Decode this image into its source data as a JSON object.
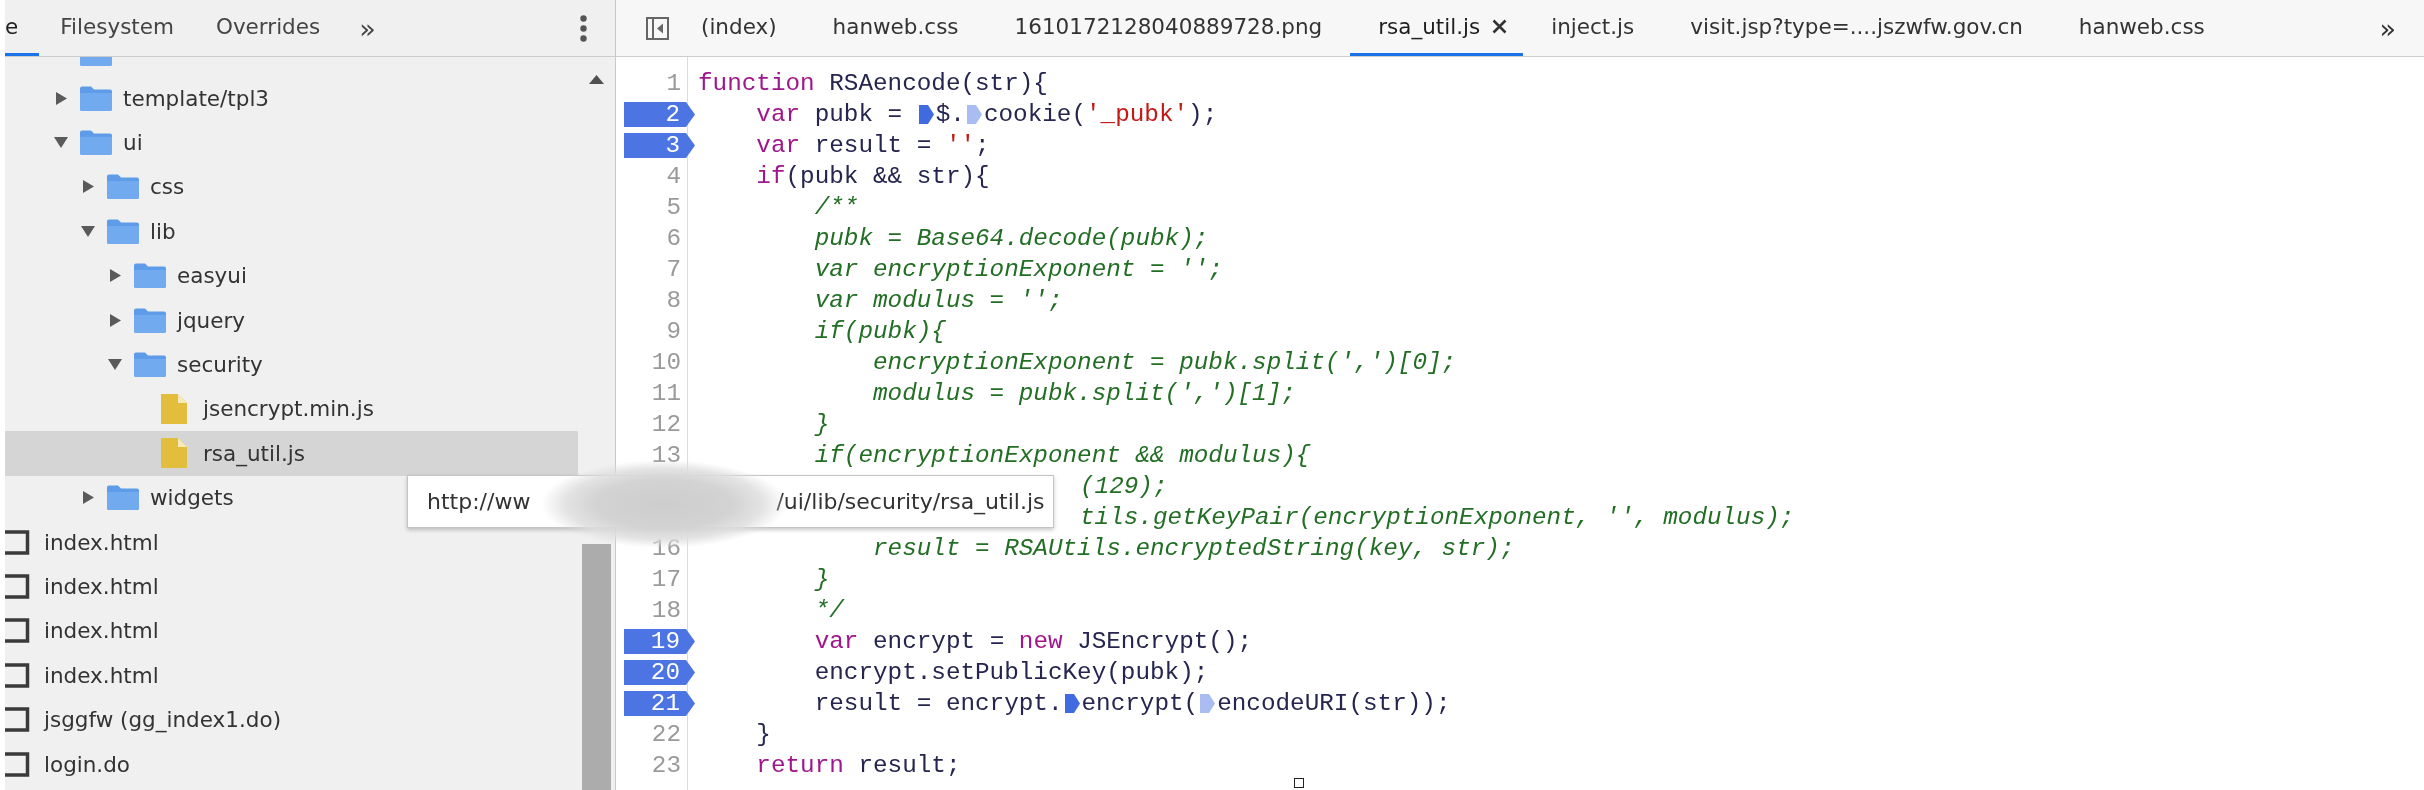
{
  "sidebar": {
    "tabs": [
      {
        "label": "e",
        "selected": true
      },
      {
        "label": "Filesystem",
        "selected": false
      },
      {
        "label": "Overrides",
        "selected": false
      }
    ],
    "more_tabs": "»",
    "tree": [
      {
        "kind": "folder",
        "selected": false
      },
      {
        "kind": "folder",
        "label": "template/tpl3",
        "expanded": false,
        "selected": false
      },
      {
        "kind": "folder",
        "label": "ui",
        "expanded": true,
        "selected": false,
        "children": [
          {
            "kind": "folder",
            "label": "css",
            "expanded": false,
            "selected": false
          },
          {
            "kind": "folder",
            "label": "lib",
            "expanded": true,
            "selected": false,
            "children": [
              {
                "kind": "folder",
                "label": "easyui",
                "expanded": false,
                "selected": false
              },
              {
                "kind": "folder",
                "label": "jquery",
                "expanded": false,
                "selected": false
              },
              {
                "kind": "folder",
                "label": "security",
                "expanded": true,
                "selected": false,
                "children": [
                  {
                    "kind": "script",
                    "label": "jsencrypt.min.js",
                    "selected": false
                  },
                  {
                    "kind": "script",
                    "label": "rsa_util.js",
                    "selected": true
                  }
                ]
              }
            ]
          },
          {
            "kind": "folder",
            "label": "widgets",
            "expanded": false,
            "selected": false
          }
        ]
      }
    ],
    "files": [
      {
        "kind": "document",
        "label": "index.html",
        "selected": false
      },
      {
        "kind": "document",
        "label": "index.html",
        "selected": false
      },
      {
        "kind": "document",
        "label": "index.html",
        "selected": false
      },
      {
        "kind": "document",
        "label": "index.html",
        "selected": false
      },
      {
        "kind": "document",
        "label": "jsggfw (gg_index1.do)",
        "selected": false
      },
      {
        "kind": "document",
        "label": "login.do",
        "selected": false
      }
    ]
  },
  "editor": {
    "tabs": [
      {
        "label": "(index)",
        "selected": false
      },
      {
        "label": "hanweb.css",
        "selected": false
      },
      {
        "label": "1610172128040889728.png",
        "selected": false
      },
      {
        "label": "rsa_util.js",
        "selected": true
      },
      {
        "label": "inject.js",
        "selected": false
      },
      {
        "label": "visit.jsp?type=....jszwfw.gov.cn",
        "selected": false
      },
      {
        "label": "hanweb.css",
        "selected": false
      }
    ],
    "more_tabs": "»",
    "lines": [
      {
        "number": "1",
        "breakpoint": false,
        "tokens": [
          {
            "kind": "keyword",
            "text": "function"
          },
          {
            "kind": "plain",
            "text": " RSAencode(str){"
          }
        ]
      },
      {
        "number": "2",
        "breakpoint": true,
        "tokens": [
          {
            "kind": "keyword",
            "text": "    var"
          },
          {
            "kind": "plain",
            "text": " pubk = "
          },
          {
            "kind": "inline_breakpoint",
            "active": true
          },
          {
            "kind": "plain",
            "text": "$."
          },
          {
            "kind": "inline_breakpoint",
            "active": false
          },
          {
            "kind": "plain",
            "text": "cookie("
          },
          {
            "kind": "string",
            "text": "'_pubk'"
          },
          {
            "kind": "plain",
            "text": ");"
          }
        ]
      },
      {
        "number": "3",
        "breakpoint": true,
        "tokens": [
          {
            "kind": "keyword",
            "text": "    var"
          },
          {
            "kind": "plain",
            "text": " result = "
          },
          {
            "kind": "string",
            "text": "''"
          },
          {
            "kind": "plain",
            "text": ";"
          }
        ]
      },
      {
        "number": "4",
        "breakpoint": false,
        "tokens": [
          {
            "kind": "keyword",
            "text": "    if"
          },
          {
            "kind": "plain",
            "text": "(pubk && str){"
          }
        ]
      },
      {
        "number": "5",
        "breakpoint": false,
        "tokens": [
          {
            "kind": "comment",
            "text": "        /**"
          }
        ]
      },
      {
        "number": "6",
        "breakpoint": false,
        "tokens": [
          {
            "kind": "comment",
            "text": "        pubk = Base64.decode(pubk);"
          }
        ]
      },
      {
        "number": "7",
        "breakpoint": false,
        "tokens": [
          {
            "kind": "comment",
            "text": "        var encryptionExponent = '';"
          }
        ]
      },
      {
        "number": "8",
        "breakpoint": false,
        "tokens": [
          {
            "kind": "comment",
            "text": "        var modulus = '';"
          }
        ]
      },
      {
        "number": "9",
        "breakpoint": false,
        "tokens": [
          {
            "kind": "comment",
            "text": "        if(pubk){"
          }
        ]
      },
      {
        "number": "10",
        "breakpoint": false,
        "tokens": [
          {
            "kind": "comment",
            "text": "            encryptionExponent = pubk.split(',')[0];"
          }
        ]
      },
      {
        "number": "11",
        "breakpoint": false,
        "tokens": [
          {
            "kind": "comment",
            "text": "            modulus = pubk.split(',')[1];"
          }
        ]
      },
      {
        "number": "12",
        "breakpoint": false,
        "tokens": [
          {
            "kind": "comment",
            "text": "        }"
          }
        ]
      },
      {
        "number": "13",
        "breakpoint": false,
        "tokens": [
          {
            "kind": "comment",
            "text": "        if(encryptionExponent && modulus){"
          }
        ]
      },
      {
        "tokens": [
          {
            "kind": "comment",
            "text": "(129);"
          }
        ]
      },
      {
        "tokens": [
          {
            "kind": "comment",
            "text": "tils.getKeyPair(encryptionExponent, '', modulus);"
          }
        ]
      },
      {
        "number": "16",
        "breakpoint": false,
        "tokens": [
          {
            "kind": "comment",
            "text": "            result = RSAUtils.encryptedString(key, str);"
          }
        ]
      },
      {
        "number": "17",
        "breakpoint": false,
        "tokens": [
          {
            "kind": "comment",
            "text": "        }"
          }
        ]
      },
      {
        "number": "18",
        "breakpoint": false,
        "tokens": [
          {
            "kind": "comment",
            "text": "        */"
          }
        ]
      },
      {
        "number": "19",
        "breakpoint": true,
        "tokens": [
          {
            "kind": "keyword",
            "text": "        var"
          },
          {
            "kind": "plain",
            "text": " encrypt = "
          },
          {
            "kind": "keyword",
            "text": "new"
          },
          {
            "kind": "plain",
            "text": " JSEncrypt();"
          }
        ]
      },
      {
        "number": "20",
        "breakpoint": true,
        "tokens": [
          {
            "kind": "plain",
            "text": "        encrypt.setPublicKey(pubk);"
          }
        ]
      },
      {
        "number": "21",
        "breakpoint": true,
        "tokens": [
          {
            "kind": "plain",
            "text": "        result = encrypt."
          },
          {
            "kind": "inline_breakpoint",
            "active": true
          },
          {
            "kind": "plain",
            "text": "encrypt("
          },
          {
            "kind": "inline_breakpoint",
            "active": false
          },
          {
            "kind": "plain",
            "text": "encodeURI(str));"
          }
        ]
      },
      {
        "number": "22",
        "breakpoint": false,
        "tokens": [
          {
            "kind": "plain",
            "text": "    }"
          }
        ]
      },
      {
        "number": "23",
        "breakpoint": false,
        "tokens": [
          {
            "kind": "keyword",
            "text": "    return"
          },
          {
            "kind": "plain",
            "text": " result;"
          }
        ]
      }
    ]
  },
  "tooltip": {
    "text_start": "http://ww",
    "text_end": "/ui/lib/security/rsa_util.js"
  }
}
